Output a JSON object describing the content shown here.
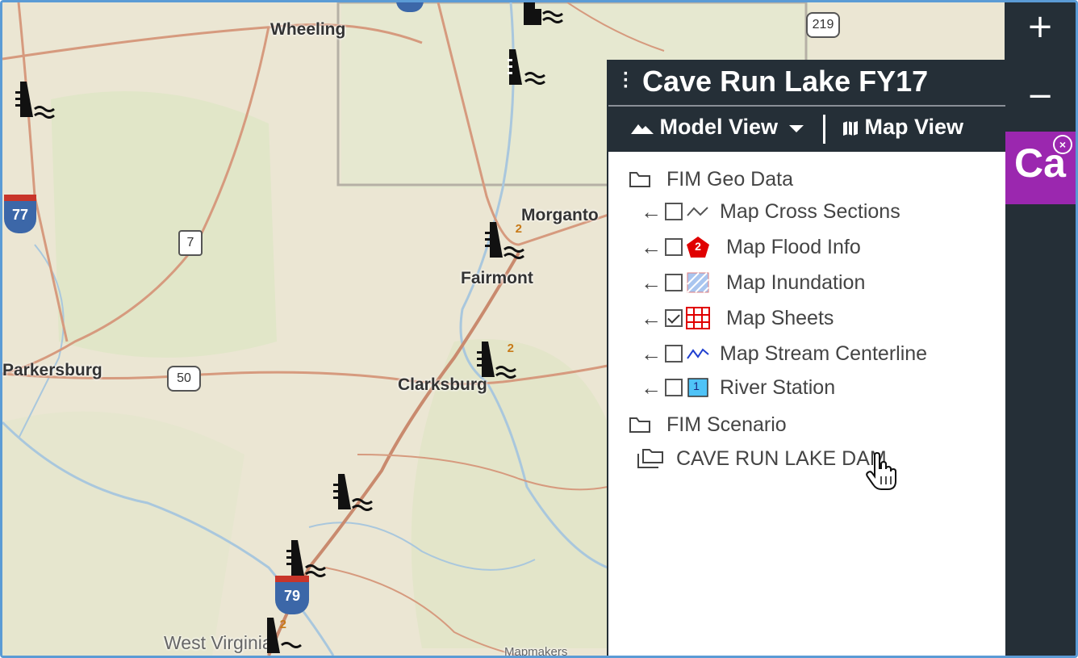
{
  "map": {
    "places": {
      "wheeling": "Wheeling",
      "morgantown": "Morganto",
      "fairmont": "Fairmont",
      "parkersburg": "Parkersburg",
      "clarksburg": "Clarksburg",
      "west_virginia": "West Virginia",
      "footer_text": "Mapmakers"
    },
    "shields": {
      "us219": "219",
      "i77": "77",
      "wv7": "7",
      "us50": "50",
      "i79": "79"
    },
    "dam_badges": {
      "fairmont_dam": "2",
      "clarksburg_dam": "2",
      "south_dam": "2"
    }
  },
  "toolbar": {
    "zoom_in": "+",
    "zoom_out": "−"
  },
  "ca_tile": {
    "label": "Ca",
    "accent": "#9b27af"
  },
  "panel": {
    "title": "Cave Run Lake FY17",
    "tabs": {
      "model_view": "Model View",
      "map_view": "Map View"
    },
    "tree": {
      "geo_data_label": "FIM Geo Data",
      "layers": [
        {
          "label": "Map Cross Sections",
          "checked": false,
          "icon": "cross-section-line-icon"
        },
        {
          "label": "Map Flood Info",
          "checked": false,
          "icon": "flood-info-pentagon-icon",
          "badge": "2"
        },
        {
          "label": "Map Inundation",
          "checked": false,
          "icon": "inundation-hatch-icon"
        },
        {
          "label": "Map Sheets",
          "checked": true,
          "icon": "map-sheets-grid-icon"
        },
        {
          "label": "Map Stream Centerline",
          "checked": false,
          "icon": "stream-line-icon"
        },
        {
          "label": "River Station",
          "checked": false,
          "icon": "river-station-box-icon",
          "badge": "1"
        }
      ],
      "scenario_label": "FIM Scenario",
      "scenario_item": "CAVE RUN LAKE DAM"
    }
  }
}
